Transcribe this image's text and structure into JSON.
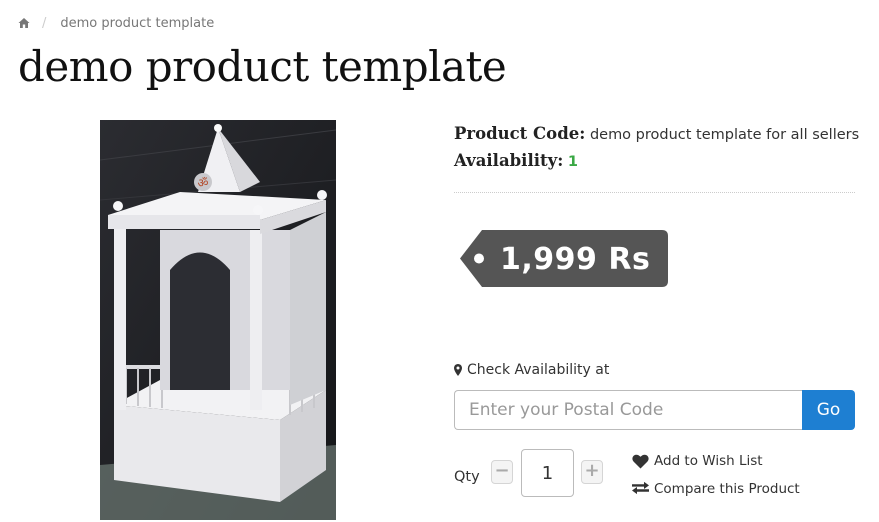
{
  "breadcrumb": {
    "home_icon": "home-icon",
    "separator": "/",
    "current": "demo product template"
  },
  "page": {
    "title": "demo product template"
  },
  "product": {
    "image_alt": "white acrylic temple",
    "code_label": "Product Code:",
    "code_value": "demo product template for all sellers",
    "availability_label": "Availability:",
    "availability_value": "1",
    "price": "1,999 Rs"
  },
  "availability_check": {
    "icon": "map-marker-icon",
    "label": "Check Availability at",
    "placeholder": "Enter your Postal Code",
    "go_label": "Go"
  },
  "quantity": {
    "label": "Qty",
    "value": "1",
    "minus": "−",
    "plus": "+"
  },
  "actions": {
    "wishlist_icon": "heart-icon",
    "wishlist_label": "Add to Wish List",
    "compare_icon": "exchange-icon",
    "compare_label": "Compare this Product"
  },
  "colors": {
    "accent": "#1e7fd2",
    "availability": "#3aa845",
    "price_tag": "#555555"
  }
}
